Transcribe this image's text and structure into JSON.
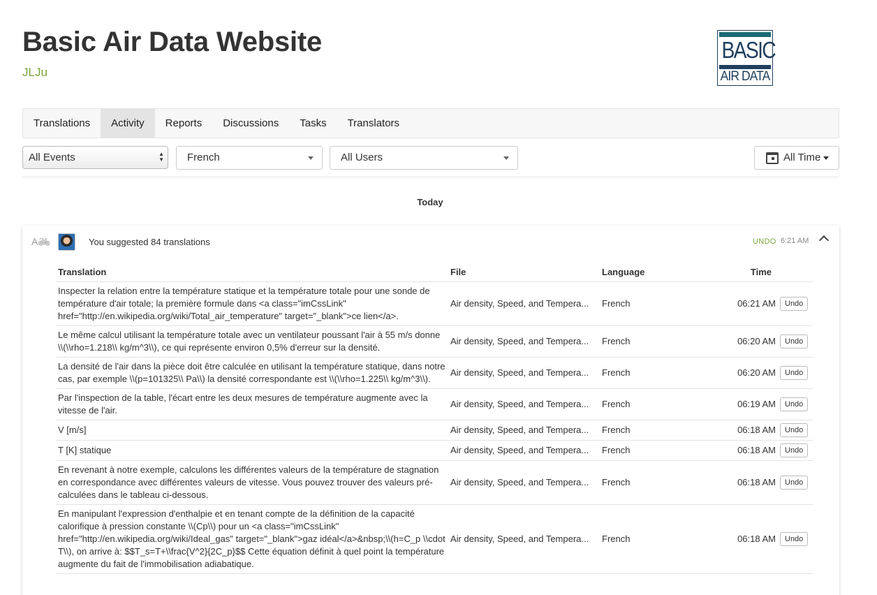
{
  "header": {
    "title": "Basic Air Data Website",
    "owner": "JLJu",
    "logo": {
      "word": "BASIC",
      "sub": "AIR DATA",
      "colors": {
        "dark": "#1f3f5e",
        "teal": "#1a6b75"
      }
    }
  },
  "nav": {
    "tabs": [
      {
        "label": "Translations"
      },
      {
        "label": "Activity"
      },
      {
        "label": "Reports"
      },
      {
        "label": "Discussions"
      },
      {
        "label": "Tasks"
      },
      {
        "label": "Translators"
      }
    ],
    "active": "Activity"
  },
  "filters": {
    "events": "All Events",
    "language": "French",
    "users": "All Users",
    "time": "All Time"
  },
  "day": "Today",
  "card": {
    "summary": "You suggested 84 translations",
    "undo_label": "UNDO",
    "time": "6:21 AM",
    "columns": {
      "translation": "Translation",
      "file": "File",
      "language": "Language",
      "time": "Time"
    },
    "rows": [
      {
        "text": "Inspecter la relation entre la température statique et la température totale pour une sonde de température d'air totale; la première formule dans <a class=\"imCssLink\" href=\"http://en.wikipedia.org/wiki/Total_air_temperature\" target=\"_blank\">ce lien</a>.",
        "file": "Air density, Speed, and Tempera...",
        "language": "French",
        "time": "06:21 AM",
        "action": "Undo"
      },
      {
        "text": "Le même calcul utilisant la température totale avec un ventilateur poussant l'air à 55 m/s donne \\\\(\\\\rho=1.218\\\\ kg/m^3\\\\), ce qui représente environ 0,5% d'erreur sur la densité.",
        "file": "Air density, Speed, and Tempera...",
        "language": "French",
        "time": "06:20 AM",
        "action": "Undo"
      },
      {
        "text": "La densité de l'air dans la pièce doit être calculée en utilisant la température statique, dans notre cas, par exemple \\\\(p=101325\\\\ Pa\\\\) la densité correspondante est \\\\(\\\\rho=1.225\\\\ kg/m^3\\\\).",
        "file": "Air density, Speed, and Tempera...",
        "language": "French",
        "time": "06:20 AM",
        "action": "Undo"
      },
      {
        "text": "Par l'inspection de la table, l'écart entre les deux mesures de température augmente avec la vitesse de l'air.",
        "file": "Air density, Speed, and Tempera...",
        "language": "French",
        "time": "06:19 AM",
        "action": "Undo"
      },
      {
        "text": "V [m/s]",
        "file": "Air density, Speed, and Tempera...",
        "language": "French",
        "time": "06:18 AM",
        "action": "Undo"
      },
      {
        "text": "T [K] statique",
        "file": "Air density, Speed, and Tempera...",
        "language": "French",
        "time": "06:18 AM",
        "action": "Undo"
      },
      {
        "text": "En revenant à notre exemple, calculons les différentes valeurs de la température de stagnation en correspondance avec différentes valeurs de vitesse. Vous pouvez trouver des valeurs pré-calculées dans le tableau ci-dessous.",
        "file": "Air density, Speed, and Tempera...",
        "language": "French",
        "time": "06:18 AM",
        "action": "Undo"
      },
      {
        "text": "En manipulant l'expression d'enthalpie et en tenant compte de la définition de la capacité calorifique à pression constante \\\\(Cp\\\\) pour un <a class=\"imCssLink\" href=\"http://en.wikipedia.org/wiki/Ideal_gas\" target=\"_blank\">gaz idéal</a>&nbsp;\\\\(h=C_p \\\\cdot T\\\\), on arrive à: $$T_s=T+\\\\frac{V^2}{2C_p}$$ Cette équation définit à quel point la température augmente du fait de l'immobilisation adiabatique.",
        "file": "Air density, Speed, and Tempera...",
        "language": "French",
        "time": "06:18 AM",
        "action": "Undo"
      }
    ]
  },
  "colors": {
    "accent": "#7aa53c",
    "text": "#333333",
    "border": "#e3e3e3"
  },
  "icons": {
    "translate": "translate-icon",
    "calendar": "calendar-icon",
    "collapse": "chevron-up-icon"
  }
}
